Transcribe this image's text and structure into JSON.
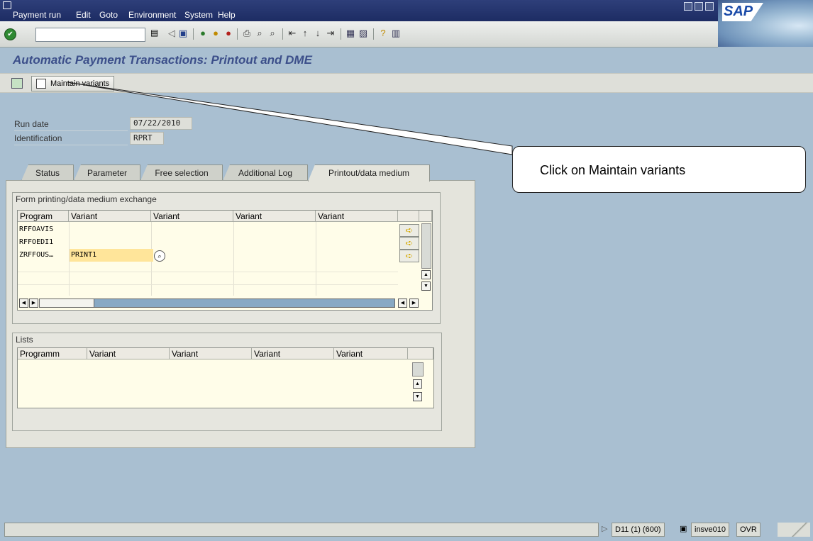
{
  "menu": {
    "items": [
      "Payment run",
      "Edit",
      "Goto",
      "Environment",
      "System",
      "Help"
    ]
  },
  "brand": {
    "logo_text": "SAP"
  },
  "toolbar": {
    "command_value": "",
    "icons": [
      "enter-icon",
      "save-icon",
      "back-icon",
      "exit-icon",
      "cancel-icon",
      "print-icon",
      "find-icon",
      "find-next-icon",
      "first-page-icon",
      "previous-page-icon",
      "next-page-icon",
      "last-page-icon",
      "create-session-icon",
      "create-shortcut-icon",
      "help-icon",
      "customize-layout-icon"
    ]
  },
  "page": {
    "title": "Automatic Payment Transactions: Printout and DME"
  },
  "app_toolbar": {
    "maintain_variants_label": "Maintain variants"
  },
  "header": {
    "run_date_label": "Run date",
    "run_date_value": "07/22/2010",
    "identification_label": "Identification",
    "identification_value": "RPRT"
  },
  "tabs": [
    {
      "label": "Status"
    },
    {
      "label": "Parameter"
    },
    {
      "label": "Free selection"
    },
    {
      "label": "Additional Log"
    },
    {
      "label": "Printout/data medium",
      "active": true
    }
  ],
  "form_group": {
    "title": "Form printing/data medium exchange",
    "columns": [
      "Program",
      "Variant",
      "Variant",
      "Variant",
      "Variant"
    ],
    "rows": [
      {
        "program": "RFFOAVIS",
        "variant": ""
      },
      {
        "program": "RFFOEDI1",
        "variant": ""
      },
      {
        "program": "ZRFFOUS…",
        "variant": "PRINT1"
      }
    ]
  },
  "lists_group": {
    "title": "Lists",
    "columns": [
      "Programm",
      "Variant",
      "Variant",
      "Variant",
      "Variant"
    ]
  },
  "callout": {
    "text": "Click on Maintain variants"
  },
  "status_bar": {
    "system": "D11 (1) (600)",
    "server": "insve010",
    "mode": "OVR"
  },
  "colors": {
    "menubar": "#1d2c63",
    "background": "#a9bfd1",
    "title": "#3c4f8a",
    "grid_bg": "#fffde9",
    "variant_highlight": "#ffe59a"
  }
}
